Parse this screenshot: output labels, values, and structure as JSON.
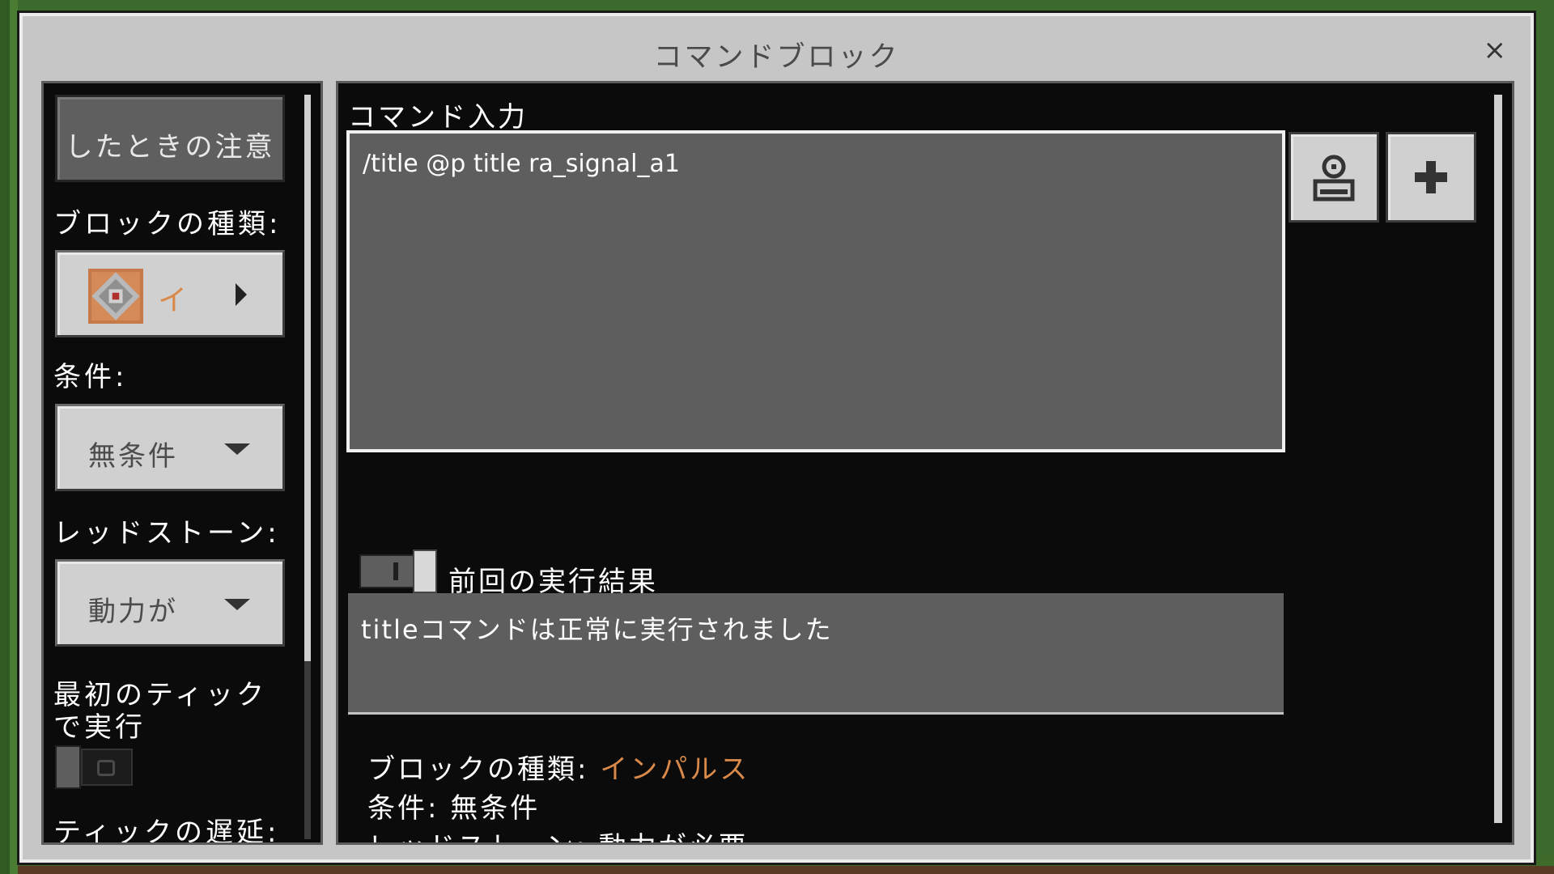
{
  "dialog": {
    "title": "コマンドブロック",
    "close_label": "×"
  },
  "left": {
    "tip_button": "したときの注意",
    "block_type_label": "ブロックの種類:",
    "block_type_value": "イ",
    "condition_label": "条件:",
    "condition_value": "無条件",
    "redstone_label": "レッドストーン:",
    "redstone_value": "動力が",
    "first_tick_label_line1": "最初のティック",
    "first_tick_label_line2": "で実行",
    "first_tick_enabled": false,
    "tick_delay_label": "ティックの遅延:"
  },
  "right": {
    "command_input_label": "コマンド入力",
    "command_text": "/title @p title ra_signal_a1",
    "previous_output_label": "前回の実行結果",
    "previous_output_enabled": true,
    "output_text": "titleコマンドは正常に実行されました",
    "info": {
      "block_type_label": "ブロックの種類:",
      "block_type_value": "インパルス",
      "condition_label": "条件:",
      "condition_value": "無条件",
      "redstone_label": "レッドストーン:",
      "redstone_value": "動力が必要"
    }
  },
  "colors": {
    "accent_orange": "#d98a4a",
    "panel_dark": "#0b0b0b",
    "dialog_bg": "#c6c6c6"
  },
  "icons": {
    "copy_button": "export-icon",
    "add_button": "plus-icon",
    "block_icon": "command-block-icon"
  }
}
